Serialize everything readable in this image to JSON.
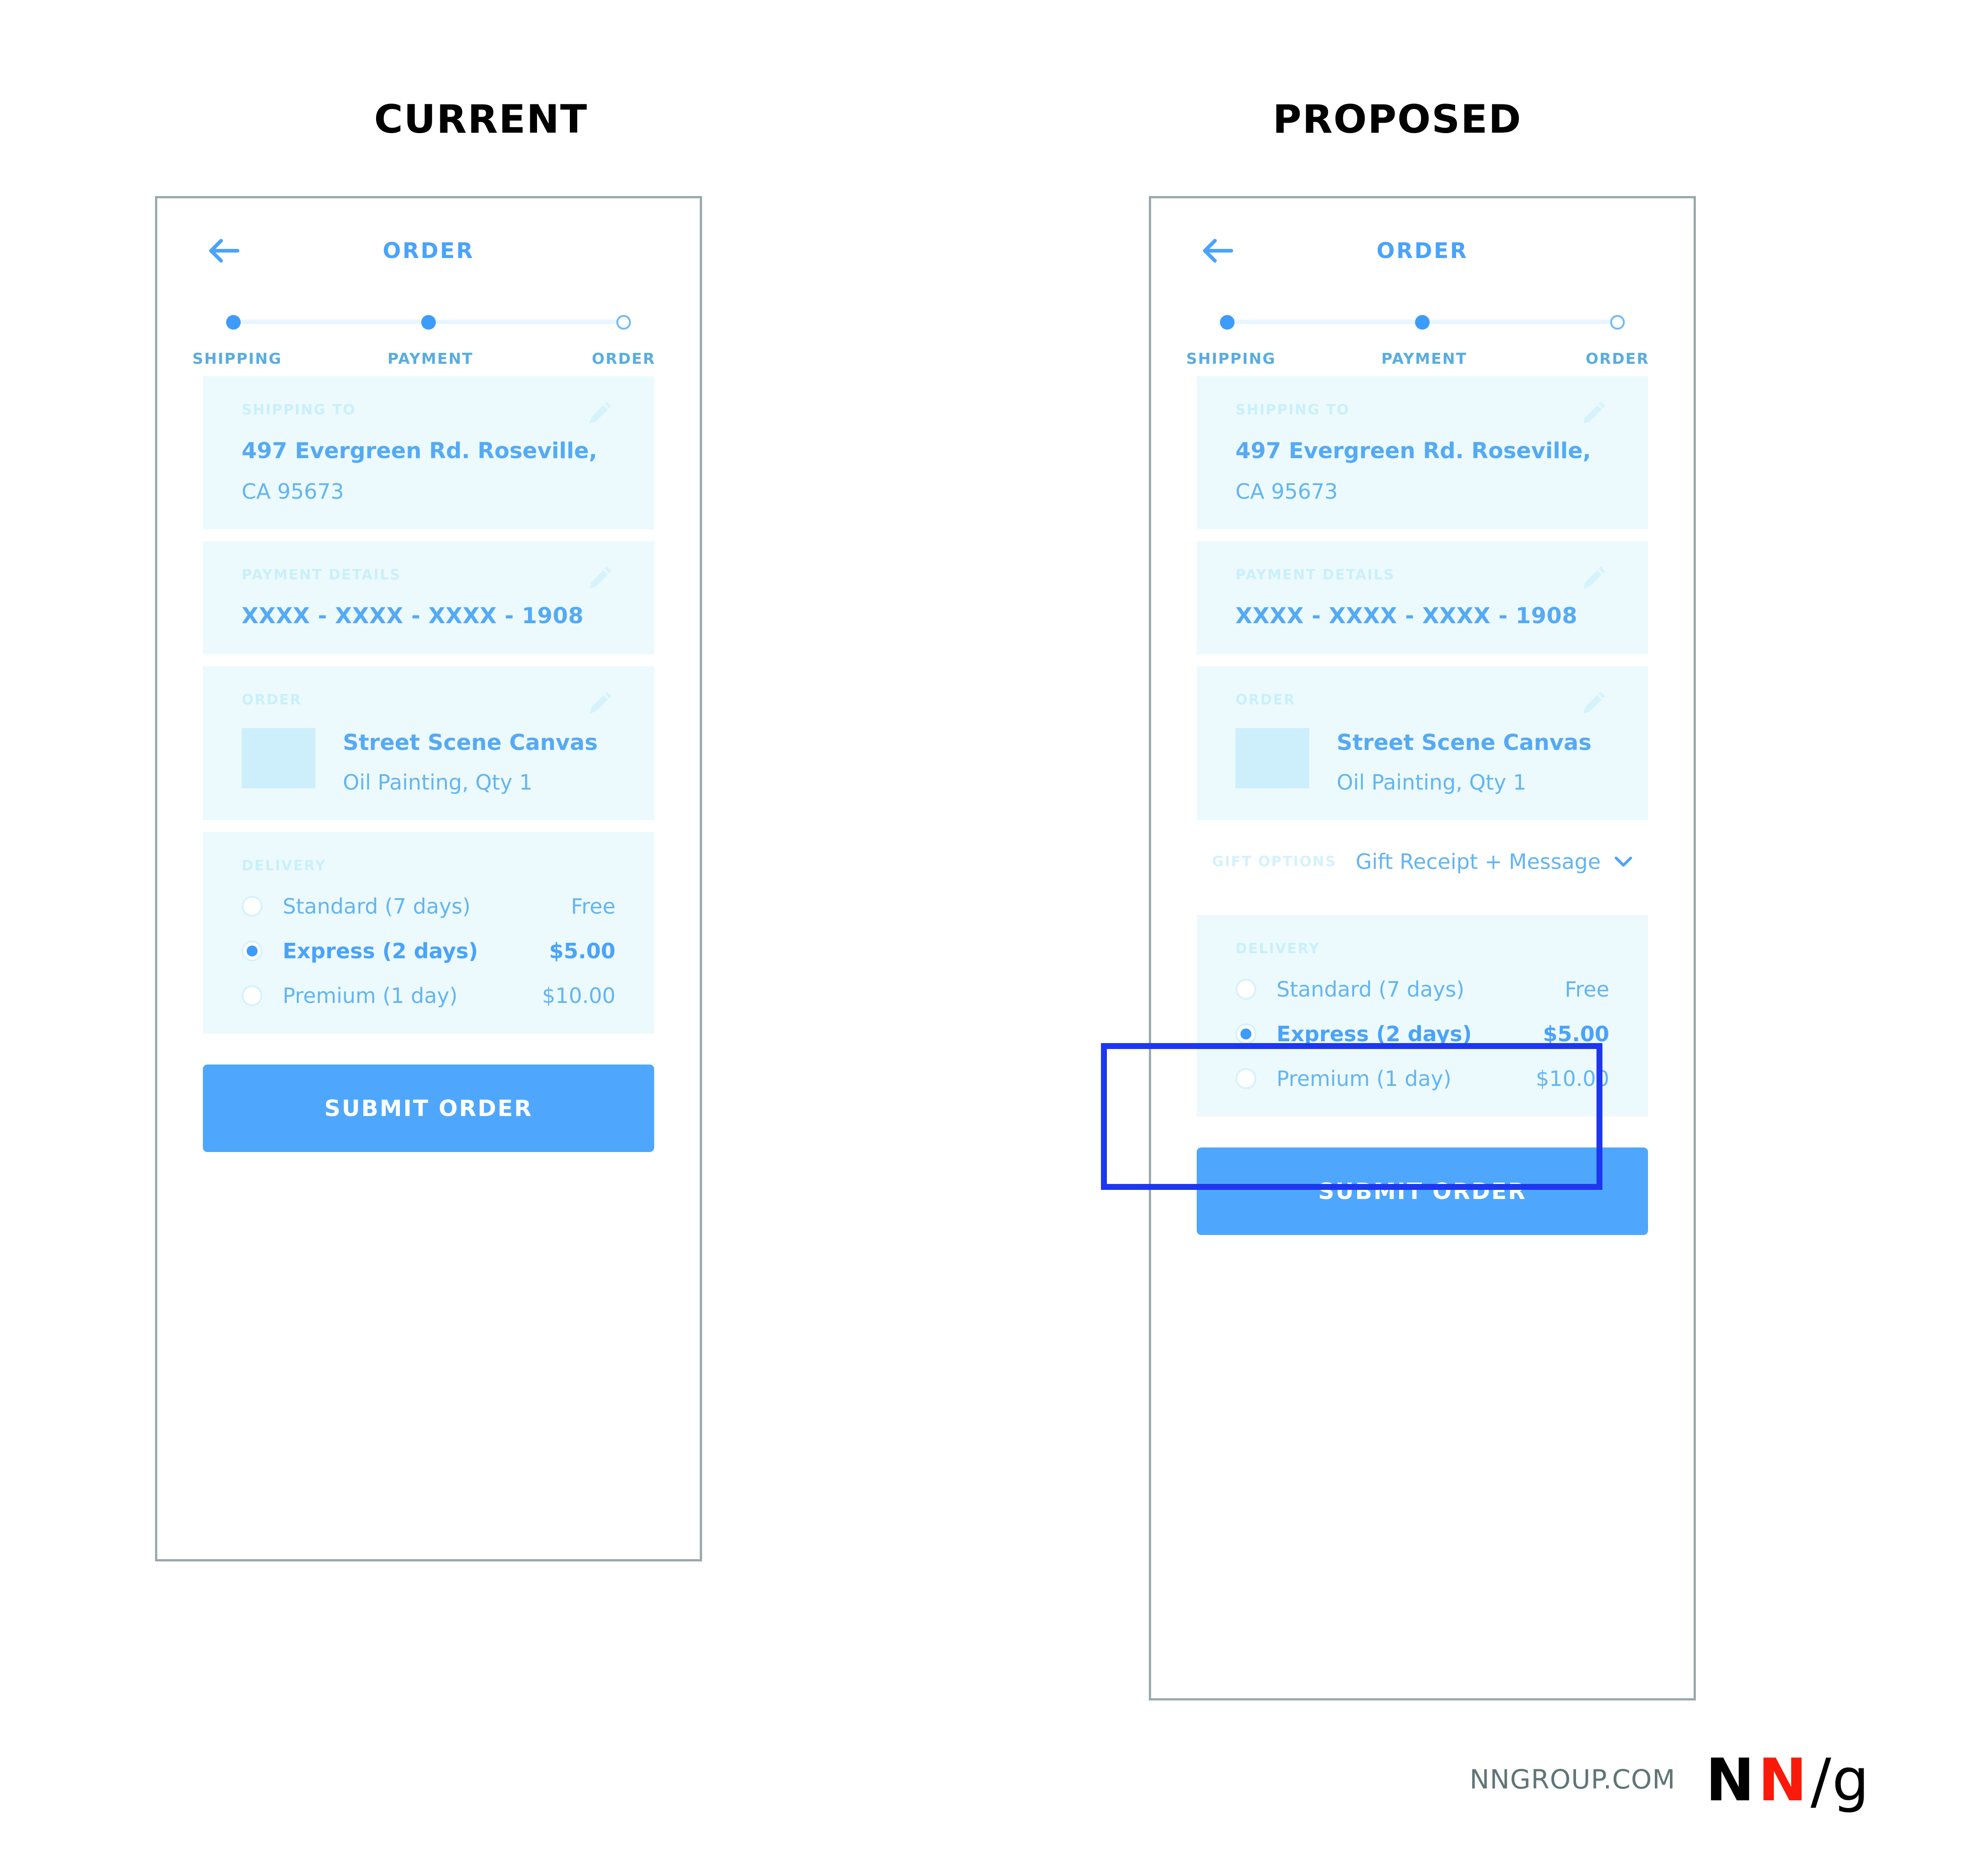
{
  "panels": {
    "current_title": "CURRENT",
    "proposed_title": "PROPOSED"
  },
  "app": {
    "back_icon": "back-arrow-icon",
    "title": "ORDER",
    "stepper": [
      {
        "label": "SHIPPING",
        "state": "complete"
      },
      {
        "label": "PAYMENT",
        "state": "complete"
      },
      {
        "label": "ORDER",
        "state": "current"
      }
    ],
    "shipping_card": {
      "label": "SHIPPING TO",
      "edit_icon": "pencil-icon",
      "address_line1": "497 Evergreen Rd. Roseville,",
      "address_line2": "CA 95673"
    },
    "payment_card": {
      "label": "PAYMENT DETAILS",
      "edit_icon": "pencil-icon",
      "card_number": "XXXX - XXXX - XXXX - 1908"
    },
    "order_card": {
      "label": "ORDER",
      "edit_icon": "pencil-icon",
      "product_name": "Street Scene Canvas",
      "product_sub": "Oil Painting, Qty 1"
    },
    "gift_card": {
      "label": "GIFT OPTIONS",
      "value": "Gift Receipt + Message",
      "chevron_icon": "chevron-down-icon"
    },
    "delivery_card": {
      "label": "DELIVERY",
      "options": [
        {
          "name": "Standard (7 days)",
          "price": "Free",
          "selected": false
        },
        {
          "name": "Express (2 days)",
          "price": "$5.00",
          "selected": true
        },
        {
          "name": "Premium (1 day)",
          "price": "$10.00",
          "selected": false
        }
      ]
    },
    "submit_label": "SUBMIT ORDER"
  },
  "footer": {
    "url": "NNGROUP.COM",
    "logo": {
      "n1": "N",
      "n2": "N",
      "slash": "/",
      "g": "g"
    }
  },
  "colors": {
    "accent_blue": "#4ea7fd",
    "card_bg": "#edfafd",
    "label_blue": "#c9f0fb",
    "text_blue": "#62b5f3",
    "highlight_blue": "#1d37f0",
    "frame_gray": "#9aaaab",
    "logo_red": "#f91a0c"
  }
}
